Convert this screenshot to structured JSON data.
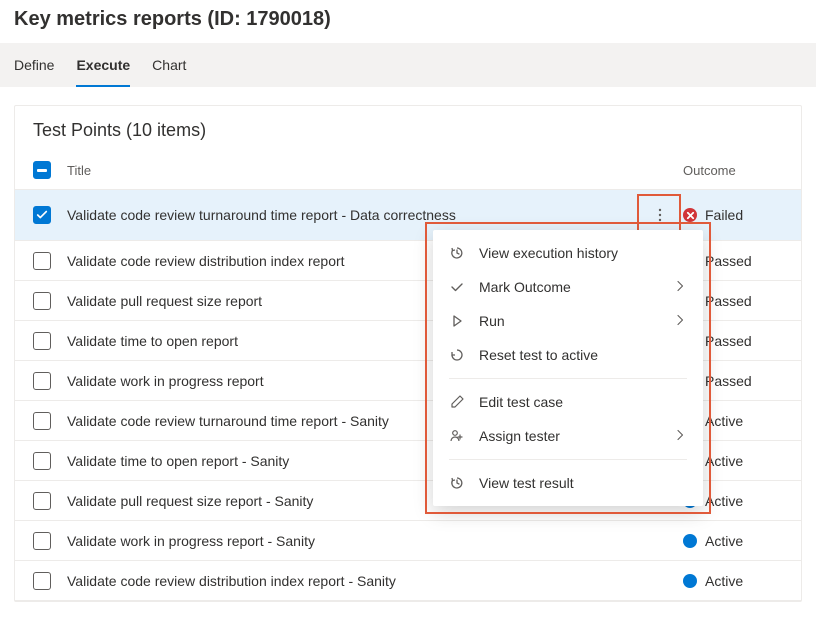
{
  "header": {
    "title": "Key metrics reports (ID: 1790018)"
  },
  "tabs": [
    {
      "label": "Define",
      "active": false
    },
    {
      "label": "Execute",
      "active": true
    },
    {
      "label": "Chart",
      "active": false
    }
  ],
  "panel": {
    "title": "Test Points (10 items)",
    "columns": {
      "title": "Title",
      "outcome": "Outcome"
    }
  },
  "rows": [
    {
      "title": "Validate code review turnaround time report - Data correctness",
      "outcome": "Failed",
      "status": "red",
      "selected": true,
      "showMenu": true
    },
    {
      "title": "Validate code review distribution index report",
      "outcome": "Passed",
      "status": "green",
      "selected": false
    },
    {
      "title": "Validate pull request size report",
      "outcome": "Passed",
      "status": "green",
      "selected": false
    },
    {
      "title": "Validate time to open report",
      "outcome": "Passed",
      "status": "green",
      "selected": false
    },
    {
      "title": "Validate work in progress report",
      "outcome": "Passed",
      "status": "green",
      "selected": false
    },
    {
      "title": "Validate code review turnaround time report - Sanity",
      "outcome": "Active",
      "status": "blue",
      "selected": false
    },
    {
      "title": "Validate time to open report - Sanity",
      "outcome": "Active",
      "status": "blue",
      "selected": false
    },
    {
      "title": "Validate pull request size report - Sanity",
      "outcome": "Active",
      "status": "blue",
      "selected": false
    },
    {
      "title": "Validate work in progress report - Sanity",
      "outcome": "Active",
      "status": "blue",
      "selected": false
    },
    {
      "title": "Validate code review distribution index report - Sanity",
      "outcome": "Active",
      "status": "blue",
      "selected": false
    }
  ],
  "contextMenu": {
    "groups": [
      [
        {
          "label": "View execution history",
          "icon": "history",
          "sub": false
        },
        {
          "label": "Mark Outcome",
          "icon": "check",
          "sub": true
        },
        {
          "label": "Run",
          "icon": "play",
          "sub": true
        },
        {
          "label": "Reset test to active",
          "icon": "reset",
          "sub": false
        }
      ],
      [
        {
          "label": "Edit test case",
          "icon": "pencil",
          "sub": false
        },
        {
          "label": "Assign tester",
          "icon": "assign",
          "sub": true
        }
      ],
      [
        {
          "label": "View test result",
          "icon": "history",
          "sub": false
        }
      ]
    ]
  }
}
